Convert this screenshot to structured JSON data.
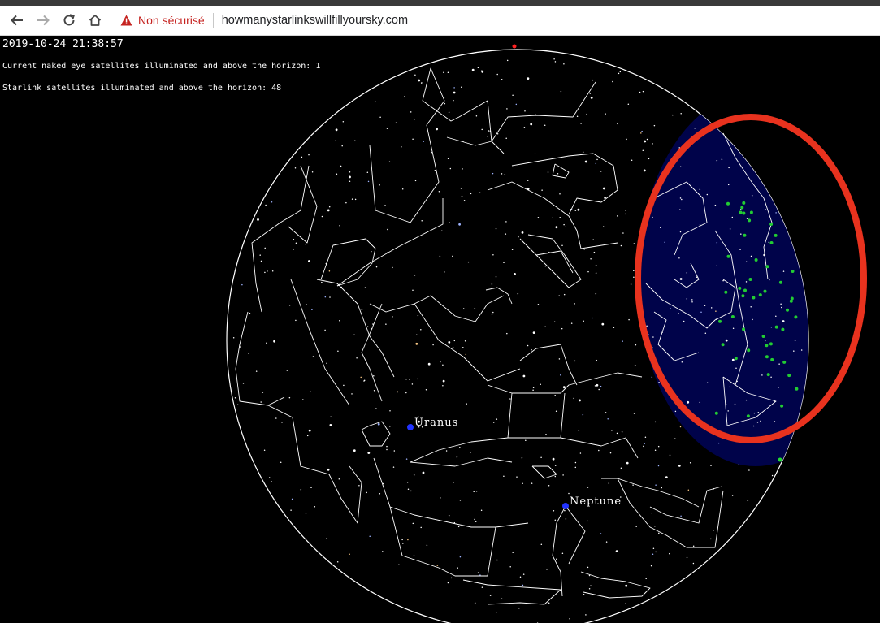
{
  "browser": {
    "security_label": "Non sécurisé",
    "url": "howmanystarlinkswillfillyoursky.com",
    "icons": [
      "back-arrow-icon",
      "forward-arrow-icon",
      "reload-icon",
      "home-icon",
      "warning-triangle-icon"
    ]
  },
  "hud": {
    "datetime": "2019-10-24 21:38:57",
    "naked_eye_line": "Current naked eye satellites illuminated and above the horizon: 1",
    "starlink_line": "Starlink satellites illuminated and above the horizon: 48"
  },
  "planets": [
    {
      "name": "Uranus",
      "color": "#2233ff"
    },
    {
      "name": "Neptune",
      "color": "#2233ff"
    }
  ],
  "colors": {
    "sky_background": "#000000",
    "constellation_lines": "#ffffff",
    "twilight_region": "#00034a",
    "starlink_satellites": "#22cc33",
    "highlight_ellipse": "#e8321e",
    "warning": "#c5221f"
  }
}
